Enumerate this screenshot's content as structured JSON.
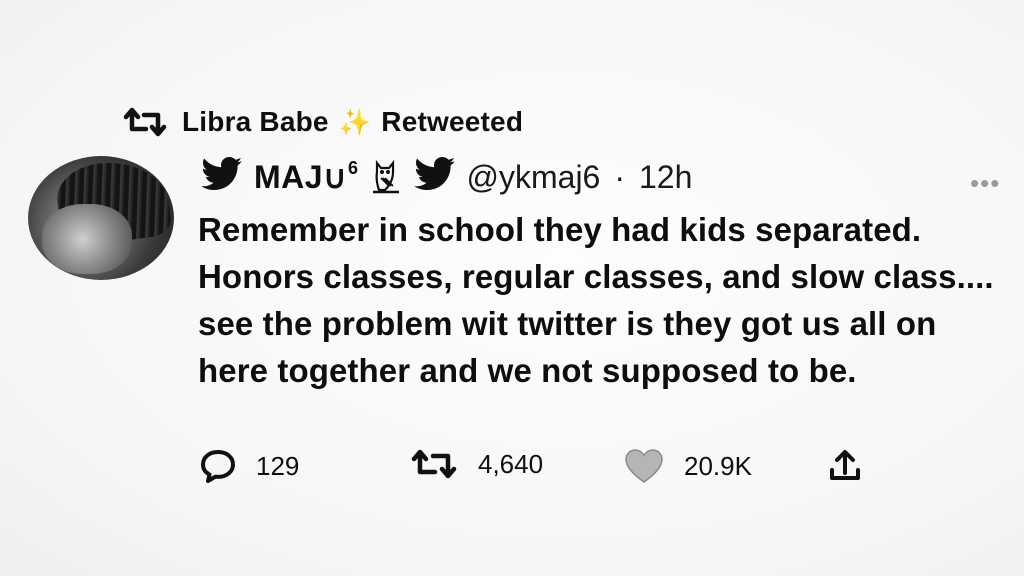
{
  "banner": {
    "retweeter_name": "Libra Babe",
    "sparkle": "✨",
    "label": "Retweeted"
  },
  "author": {
    "display_name": "MAJ∪",
    "superscript": "6",
    "handle": "@ykmaj6",
    "separator": "·",
    "time": "12h"
  },
  "more_menu": "•••",
  "tweet": {
    "text": "Remember in school they had kids separated. Honors classes, regular classes, and slow class.... see the problem wit twitter is they got us all on here together and we not supposed to be."
  },
  "actions": {
    "replies": "129",
    "retweets": "4,640",
    "likes": "20.9K"
  },
  "icons": {
    "retweet": "retweet-icon",
    "bird": "bird-icon",
    "owl": "owl-icon",
    "reply": "reply-icon",
    "like": "heart-icon",
    "share": "share-icon",
    "more": "more-icon"
  },
  "colors": {
    "background": "#f9f9f9",
    "text": "#0f0f0f",
    "heart_fill": "#b5b5b5"
  }
}
